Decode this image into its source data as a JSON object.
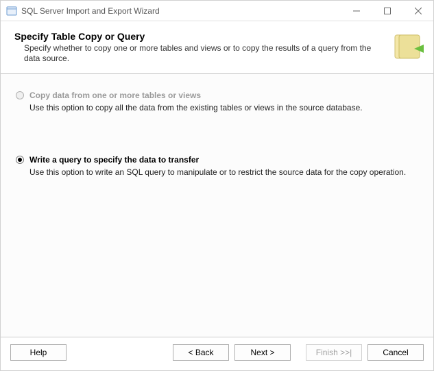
{
  "window": {
    "title": "SQL Server Import and Export Wizard"
  },
  "header": {
    "title": "Specify Table Copy or Query",
    "description": "Specify whether to copy one or more tables and views or to copy the results of a query from the data source."
  },
  "options": {
    "copy": {
      "label": "Copy data from one or more tables or views",
      "description": "Use this option to copy all the data from the existing tables or views in the source database.",
      "selected": false,
      "enabled": false
    },
    "query": {
      "label": "Write a query to specify the data to transfer",
      "description": "Use this option to write an SQL query to manipulate or to restrict the source data for the copy operation.",
      "selected": true,
      "enabled": true
    }
  },
  "footer": {
    "help": "Help",
    "back": "< Back",
    "next": "Next >",
    "finish": "Finish >>|",
    "cancel": "Cancel"
  }
}
